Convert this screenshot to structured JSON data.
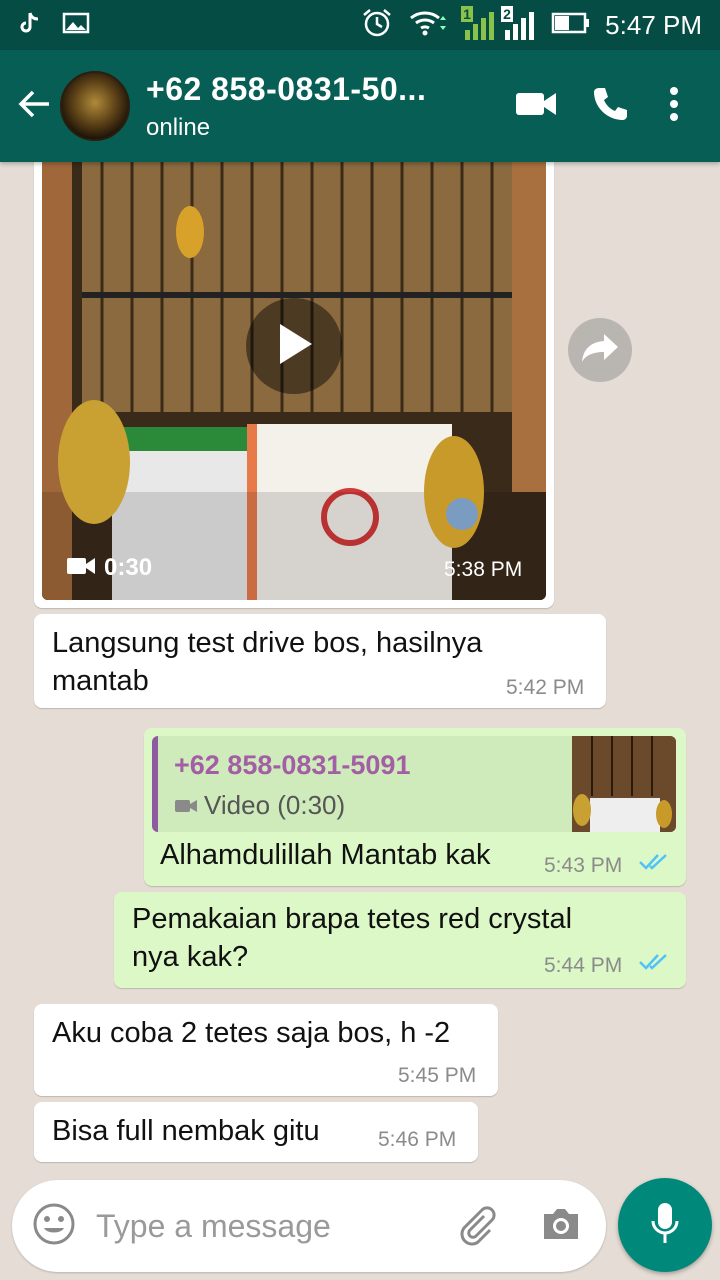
{
  "status_bar": {
    "time": "5:47 PM",
    "sim1": "1",
    "sim2": "2"
  },
  "header": {
    "contact_name": "+62 858-0831-50...",
    "contact_status": "online"
  },
  "messages": [
    {
      "type": "video-in",
      "duration": "0:30",
      "time": "5:38 PM"
    },
    {
      "type": "text-in",
      "lines": [
        "Langsung test drive bos, hasilnya",
        "mantab"
      ],
      "time": "5:42 PM"
    },
    {
      "type": "reply-out",
      "quoted_name": "+62 858-0831-5091",
      "quoted_label": "Video (0:30)",
      "text": "Alhamdulillah Mantab kak",
      "time": "5:43 PM"
    },
    {
      "type": "text-out",
      "lines": [
        "Pemakaian brapa tetes red crystal",
        "nya kak?"
      ],
      "time": "5:44 PM"
    },
    {
      "type": "text-in",
      "lines": [
        "Aku coba 2 tetes saja bos, h -2"
      ],
      "time": "5:45 PM"
    },
    {
      "type": "text-in",
      "lines": [
        "Bisa full nembak gitu"
      ],
      "time": "5:46 PM"
    }
  ],
  "input": {
    "placeholder": "Type a message"
  },
  "colors": {
    "header": "#075e54",
    "status_bar": "#054d44",
    "outgoing_bubble": "#dcf8c6",
    "incoming_bubble": "#ffffff",
    "chat_background": "#e5ddd5",
    "read_ticks": "#4fc3f7",
    "quote_accent": "#a35fa4",
    "fab": "#00897b"
  },
  "icons": [
    "tiktok-icon",
    "gallery-icon",
    "alarm-icon",
    "wifi-icon",
    "signal-icon",
    "battery-icon",
    "back-arrow-icon",
    "video-call-icon",
    "phone-icon",
    "more-vert-icon",
    "play-icon",
    "video-camera-icon",
    "forward-icon",
    "emoji-icon",
    "attach-icon",
    "camera-icon",
    "mic-icon"
  ]
}
